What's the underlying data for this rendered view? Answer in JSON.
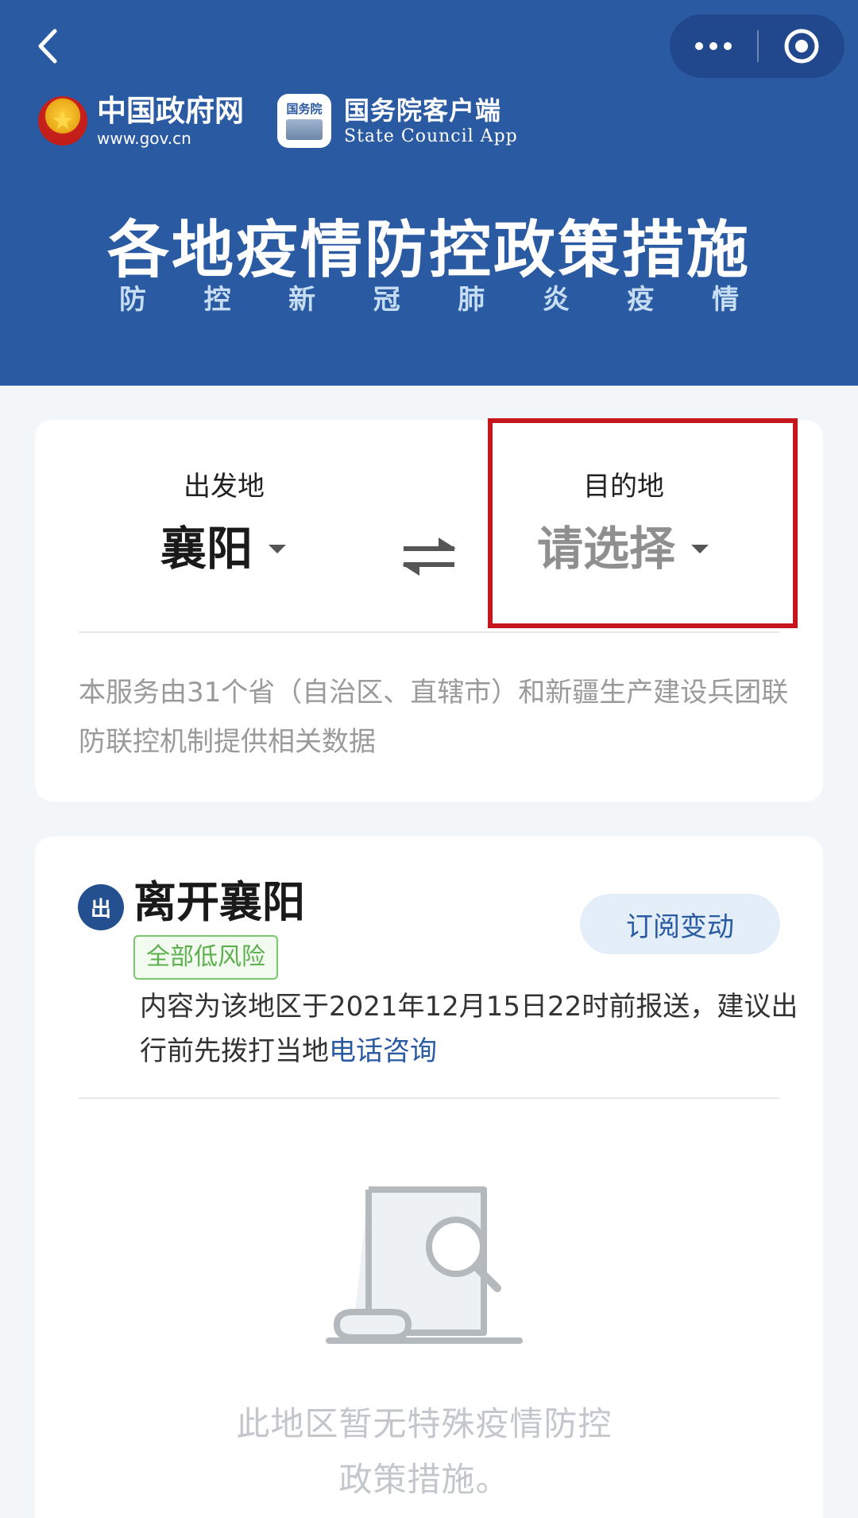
{
  "header": {
    "gov_name": "中国政府网",
    "gov_url": "www.gov.cn",
    "app_icon_text": "国务院",
    "app_name": "国务院客户端",
    "app_sub": "State Council App",
    "title": "各地疫情防控政策措施",
    "subtitle_chars": [
      "防",
      "控",
      "新",
      "冠",
      "肺",
      "炎",
      "疫",
      "情"
    ]
  },
  "route": {
    "origin_label": "出发地",
    "origin_value": "襄阳",
    "destination_label": "目的地",
    "destination_placeholder": "请选择",
    "note": "本服务由31个省（自治区、直辖市）和新疆生产建设兵团联防联控机制提供相关数据"
  },
  "departure": {
    "badge": "出",
    "title": "离开襄阳",
    "risk": "全部低风险",
    "subscribe": "订阅变动",
    "info_text": "内容为该地区于2021年12月15日22时前报送，建议出行前先拨打当地",
    "info_link": "电话咨询",
    "empty_line1": "此地区暂无特殊疫情防控",
    "empty_line2": "政策措施。"
  },
  "colors": {
    "header_bg": "#2a5aa2",
    "highlight": "#c4161c",
    "risk_green": "#5cb04e",
    "link_blue": "#2a5aa2"
  },
  "icons": [
    "back-chevron-icon",
    "more-dots-icon",
    "target-icon",
    "swap-arrows-icon",
    "document-search-icon"
  ]
}
